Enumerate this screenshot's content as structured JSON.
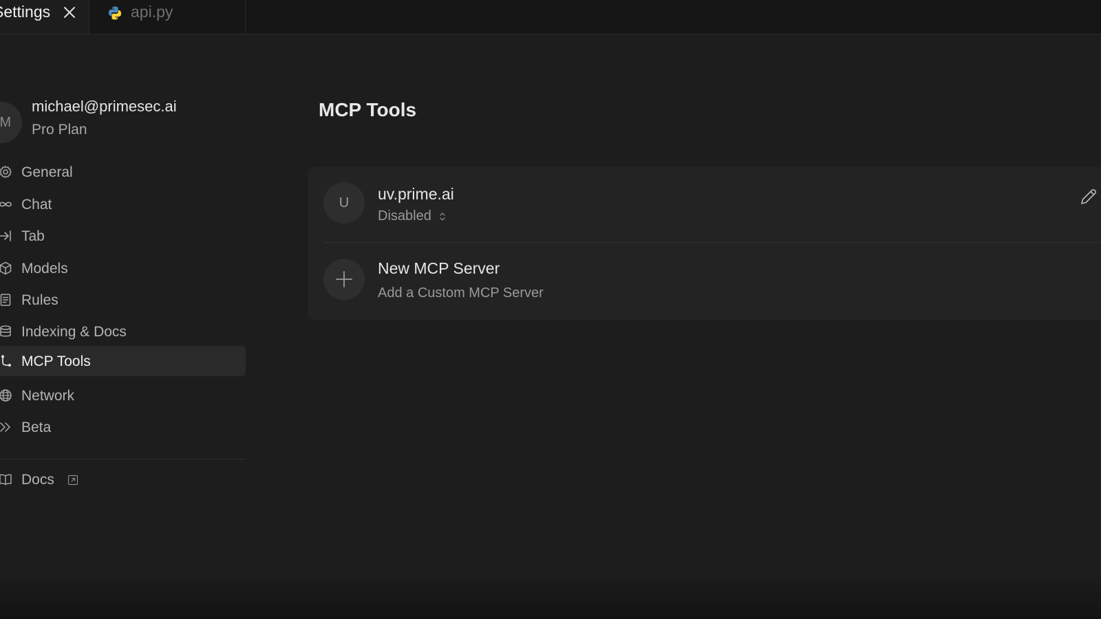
{
  "tabs": {
    "settings_label": "Settings",
    "api_label": "api.py"
  },
  "account": {
    "avatar_initial": "M",
    "email": "michael@primesec.ai",
    "plan": "Pro Plan"
  },
  "sidebar": {
    "items": [
      {
        "label": "General",
        "icon": "gear-icon"
      },
      {
        "label": "Chat",
        "icon": "infinity-icon"
      },
      {
        "label": "Tab",
        "icon": "arrow-right-bar-icon"
      },
      {
        "label": "Models",
        "icon": "cube-icon"
      },
      {
        "label": "Rules",
        "icon": "document-icon"
      },
      {
        "label": "Indexing & Docs",
        "icon": "database-icon"
      },
      {
        "label": "MCP Tools",
        "icon": "mcp-icon",
        "active": true
      },
      {
        "label": "Network",
        "icon": "globe-icon"
      },
      {
        "label": "Beta",
        "icon": "chevrons-right-icon"
      }
    ],
    "docs": {
      "label": "Docs",
      "icon": "book-icon"
    }
  },
  "main": {
    "title": "MCP Tools",
    "servers": [
      {
        "avatar": "U",
        "name": "uv.prime.ai",
        "status": "Disabled"
      }
    ],
    "add_server": {
      "title": "New MCP Server",
      "subtitle": "Add a Custom MCP Server"
    }
  },
  "colors": {
    "background": "#1d1d1d",
    "tabbar": "#161616",
    "card": "#232323",
    "active_nav": "#2a2a2a",
    "python_blue": "#4b8bbe",
    "python_yellow": "#ffd43b"
  }
}
